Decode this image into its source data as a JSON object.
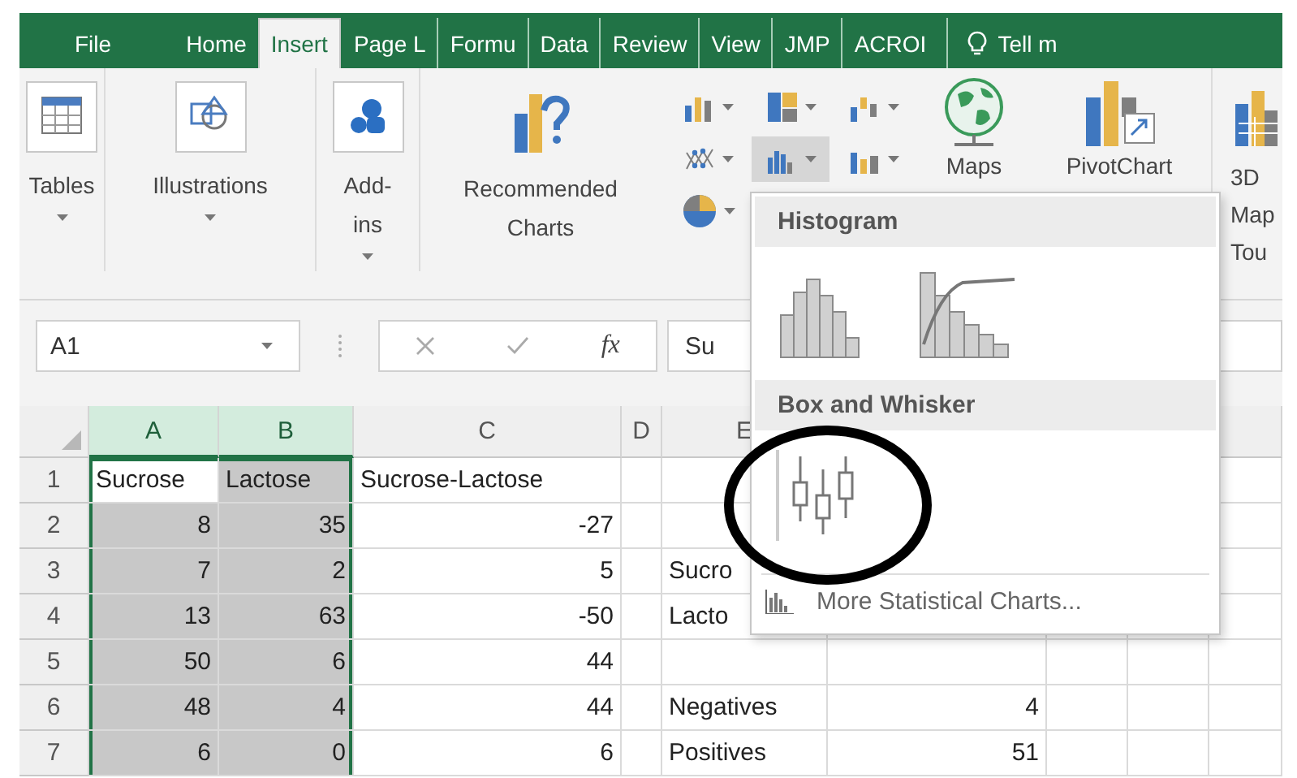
{
  "tabs": [
    {
      "label": "File",
      "selected": false
    },
    {
      "label": "Home",
      "selected": false
    },
    {
      "label": "Insert",
      "selected": true
    },
    {
      "label": "Page L",
      "selected": false
    },
    {
      "label": "Formu",
      "selected": false
    },
    {
      "label": "Data",
      "selected": false
    },
    {
      "label": "Review",
      "selected": false
    },
    {
      "label": "View",
      "selected": false
    },
    {
      "label": "JMP",
      "selected": false
    },
    {
      "label": "ACROI",
      "selected": false
    }
  ],
  "tell_me": "Tell m",
  "ribbon": {
    "groups": [
      {
        "kind": "tables",
        "label": "Tables",
        "dropdown": true
      },
      {
        "kind": "illustrations",
        "label": "Illustrations",
        "dropdown": true
      },
      {
        "kind": "addins",
        "label": "Add-ins",
        "dropdown": true
      },
      {
        "kind": "recommended",
        "label": "Recommended Charts",
        "dropdown": false
      },
      {
        "kind": "charts",
        "buttons": [
          {
            "kind": "column",
            "selected": false
          },
          {
            "kind": "hierarchy",
            "selected": false
          },
          {
            "kind": "waterfall",
            "selected": false
          },
          {
            "kind": "scatter",
            "selected": false
          },
          {
            "kind": "statistic",
            "selected": true
          },
          {
            "kind": "combo",
            "selected": false
          },
          {
            "kind": "pie",
            "selected": false
          }
        ]
      },
      {
        "kind": "maps",
        "label": "Maps",
        "dropdown": false
      },
      {
        "kind": "pivotchart",
        "label": "PivotChart",
        "dropdown": false
      },
      {
        "kind": "tour",
        "label": "3D Map Tou",
        "dropdown": false
      }
    ]
  },
  "formula_bar": {
    "name_box": "A1",
    "function_symbol": "fx",
    "value": "Su"
  },
  "sheet": {
    "columns": [
      {
        "label": "A",
        "selected": true
      },
      {
        "label": "B",
        "selected": true
      },
      {
        "label": "C",
        "selected": false
      },
      {
        "label": "D",
        "selected": false
      },
      {
        "label": "E",
        "selected": false
      }
    ],
    "rows": [
      {
        "label": "1",
        "cells": [
          {
            "text": "Sucrose",
            "kind": "text",
            "selected": false
          },
          {
            "text": "Lactose",
            "kind": "text",
            "selected": true
          },
          {
            "text": "Sucrose-Lactose",
            "kind": "text",
            "selected": false
          },
          null,
          null,
          null,
          null,
          null,
          null
        ]
      },
      {
        "label": "2",
        "cells": [
          {
            "text": "8",
            "kind": "number",
            "selected": true
          },
          {
            "text": "35",
            "kind": "number",
            "selected": true
          },
          {
            "text": "-27",
            "kind": "number",
            "selected": false
          },
          null,
          null,
          null,
          null,
          null,
          null
        ]
      },
      {
        "label": "3",
        "cells": [
          {
            "text": "7",
            "kind": "number",
            "selected": true
          },
          {
            "text": "2",
            "kind": "number",
            "selected": true
          },
          {
            "text": "5",
            "kind": "number",
            "selected": false
          },
          null,
          {
            "text": "Sucro",
            "kind": "text",
            "selected": false
          },
          null,
          null,
          null,
          null
        ]
      },
      {
        "label": "4",
        "cells": [
          {
            "text": "13",
            "kind": "number",
            "selected": true
          },
          {
            "text": "63",
            "kind": "number",
            "selected": true
          },
          {
            "text": "-50",
            "kind": "number",
            "selected": false
          },
          null,
          {
            "text": "Lacto",
            "kind": "text",
            "selected": false
          },
          null,
          null,
          null,
          null
        ]
      },
      {
        "label": "5",
        "cells": [
          {
            "text": "50",
            "kind": "number",
            "selected": true
          },
          {
            "text": "6",
            "kind": "number",
            "selected": true
          },
          {
            "text": "44",
            "kind": "number",
            "selected": false
          },
          null,
          null,
          null,
          null,
          null,
          null
        ]
      },
      {
        "label": "6",
        "cells": [
          {
            "text": "48",
            "kind": "number",
            "selected": true
          },
          {
            "text": "4",
            "kind": "number",
            "selected": true
          },
          {
            "text": "44",
            "kind": "number",
            "selected": false
          },
          null,
          {
            "text": "Negatives",
            "kind": "text",
            "selected": false
          },
          {
            "text": "4",
            "kind": "number",
            "selected": false
          },
          null,
          null,
          null
        ]
      },
      {
        "label": "7",
        "cells": [
          {
            "text": "6",
            "kind": "number",
            "selected": true
          },
          {
            "text": "0",
            "kind": "number",
            "selected": true
          },
          {
            "text": "6",
            "kind": "number",
            "selected": false
          },
          null,
          {
            "text": "Positives",
            "kind": "text",
            "selected": false
          },
          {
            "text": "51",
            "kind": "number",
            "selected": false
          },
          null,
          null,
          null
        ]
      }
    ]
  },
  "chart_menu": {
    "sections": [
      {
        "title": "Histogram",
        "items": [
          {
            "kind": "histogram"
          },
          {
            "kind": "pareto"
          }
        ]
      },
      {
        "title": "Box and Whisker",
        "items": [
          {
            "kind": "box-whisker"
          }
        ]
      }
    ],
    "more": "More Statistical Charts..."
  },
  "annotation": {
    "kind": "circle"
  }
}
